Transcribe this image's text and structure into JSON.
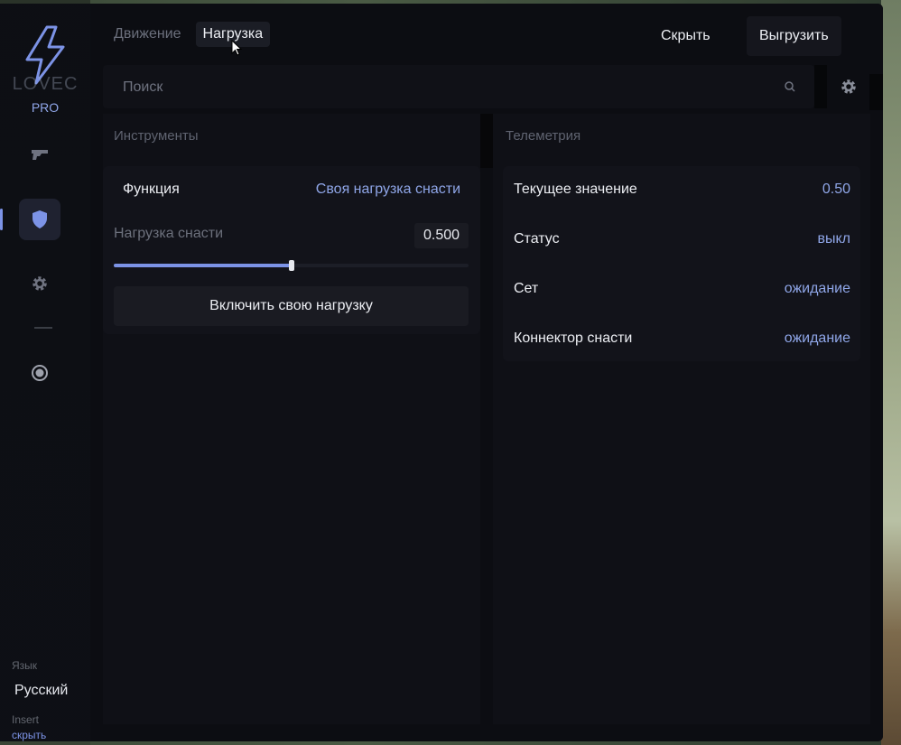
{
  "brand": {
    "name": "LOVEC",
    "edition": "PRO",
    "accent": "#7c93e6"
  },
  "sidebar": {
    "items": [
      {
        "icon": "gun-icon"
      },
      {
        "icon": "shield-icon",
        "active": true
      },
      {
        "icon": "gear-icon"
      },
      {
        "icon": "radio-icon"
      }
    ],
    "language_label": "Язык",
    "language_value": "Русский",
    "hotkey_label": "Insert",
    "hide_label": "скрыть"
  },
  "header": {
    "tabs": [
      {
        "label": "Движение",
        "active": false
      },
      {
        "label": "Нагрузка",
        "active": true
      }
    ],
    "hide_button": "Скрыть",
    "unload_button": "Выгрузить"
  },
  "search": {
    "placeholder": "Поиск",
    "value": ""
  },
  "tools": {
    "title": "Инструменты",
    "function_label": "Функция",
    "function_value": "Своя нагрузка снасти",
    "slider_label": "Нагрузка снасти",
    "slider_value": "0.500",
    "slider_fraction": 0.5,
    "action_button": "Включить свою нагрузку"
  },
  "telemetry": {
    "title": "Телеметрия",
    "rows": [
      {
        "label": "Текущее значение",
        "value": "0.50"
      },
      {
        "label": "Статус",
        "value": "выкл"
      },
      {
        "label": "Сет",
        "value": "ожидание"
      },
      {
        "label": "Коннектор снасти",
        "value": "ожидание"
      }
    ]
  }
}
